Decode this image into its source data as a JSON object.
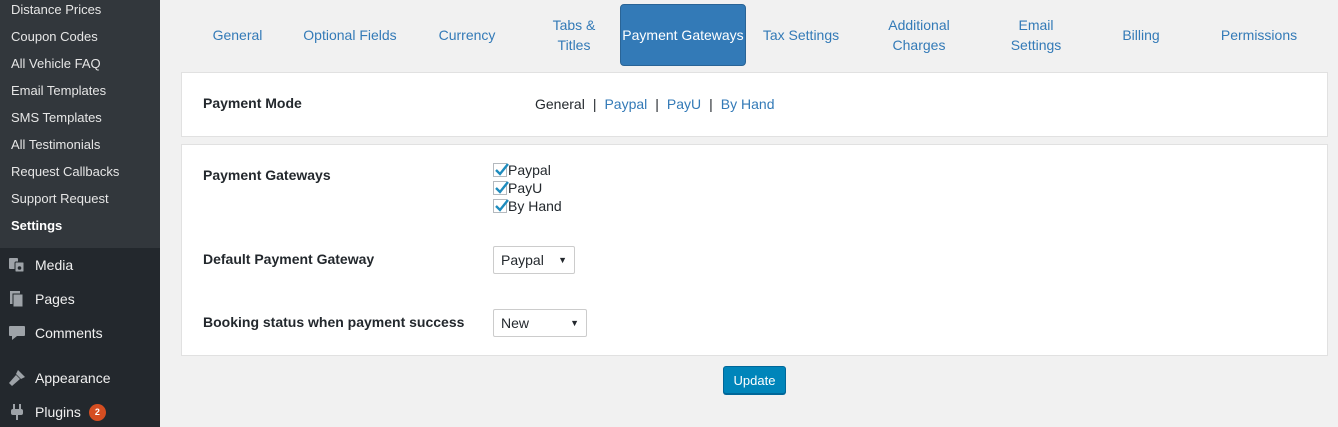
{
  "sidebar": {
    "submenu": [
      {
        "label": "Distance Prices"
      },
      {
        "label": "Coupon Codes"
      },
      {
        "label": "All Vehicle FAQ"
      },
      {
        "label": "Email Templates"
      },
      {
        "label": "SMS Templates"
      },
      {
        "label": "All Testimonials"
      },
      {
        "label": "Request Callbacks"
      },
      {
        "label": "Support Request"
      },
      {
        "label": "Settings",
        "current": true
      }
    ],
    "menu": [
      {
        "label": "Media",
        "icon": "media-icon"
      },
      {
        "label": "Pages",
        "icon": "pages-icon"
      },
      {
        "label": "Comments",
        "icon": "comments-icon"
      },
      {
        "label": "Appearance",
        "icon": "appearance-icon"
      },
      {
        "label": "Plugins",
        "icon": "plugins-icon",
        "badge": "2"
      }
    ]
  },
  "tabs": [
    {
      "label": "General"
    },
    {
      "label": "Optional Fields"
    },
    {
      "label": "Currency"
    },
    {
      "label": "Tabs & Titles"
    },
    {
      "label": "Payment Gateways",
      "active": true
    },
    {
      "label": "Tax Settings"
    },
    {
      "label": "Additional Charges"
    },
    {
      "label": "Email Settings"
    },
    {
      "label": "Billing"
    },
    {
      "label": "Permissions"
    }
  ],
  "payment_mode": {
    "label": "Payment Mode",
    "current": "General",
    "separator": "|",
    "links": [
      "Paypal",
      "PayU",
      "By Hand"
    ]
  },
  "gateways": {
    "label": "Payment Gateways",
    "options": [
      {
        "label": "Paypal",
        "checked": true
      },
      {
        "label": "PayU",
        "checked": true
      },
      {
        "label": "By Hand",
        "checked": true
      }
    ]
  },
  "default_gateway": {
    "label": "Default Payment Gateway",
    "value": "Paypal"
  },
  "booking_status": {
    "label": "Booking status when payment success",
    "value": "New"
  },
  "update_label": "Update",
  "colors": {
    "sidebar_bg": "#23282d",
    "submenu_bg": "#32373c",
    "accent": "#337ab7",
    "button": "#0085ba",
    "badge": "#d54e21"
  }
}
